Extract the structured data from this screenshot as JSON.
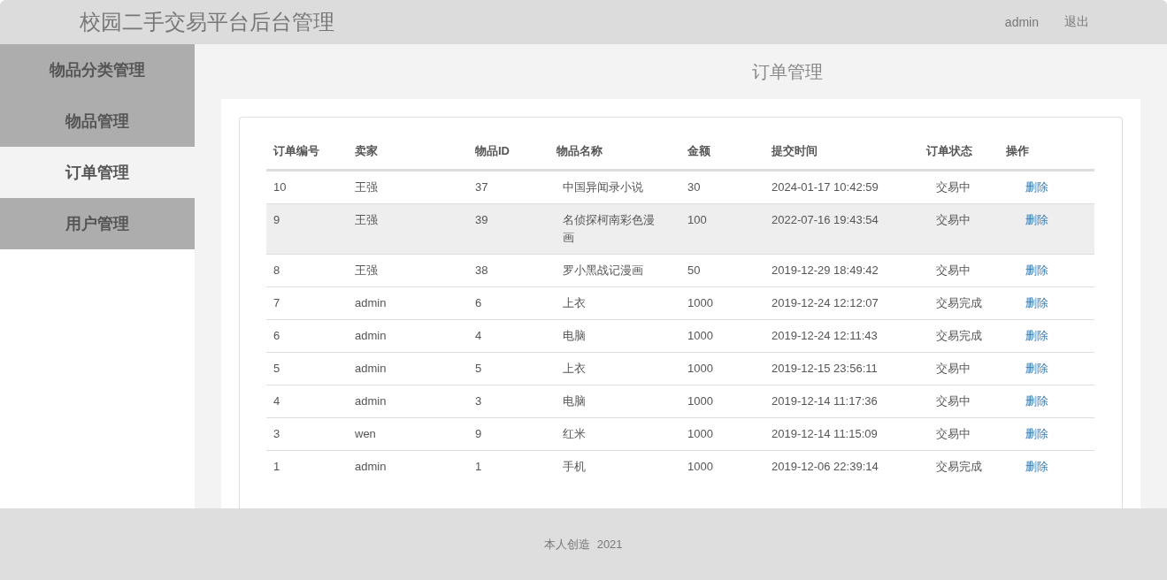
{
  "header": {
    "title": "校园二手交易平台后台管理",
    "user": "admin",
    "logout": "退出"
  },
  "sidebar": {
    "items": [
      {
        "label": "物品分类管理",
        "selected": false
      },
      {
        "label": "物品管理",
        "selected": false
      },
      {
        "label": "订单管理",
        "selected": true
      },
      {
        "label": "用户管理",
        "selected": false
      }
    ]
  },
  "page_title": "订单管理",
  "table": {
    "columns": [
      "订单编号",
      "卖家",
      "物品ID",
      "物品名称",
      "金额",
      "提交时间",
      "订单状态",
      "操作"
    ],
    "rows": [
      {
        "cells": [
          "10",
          "王强",
          "37",
          "中国异闻录小说",
          "30",
          "2024-01-17 10:42:59",
          "交易中",
          "删除"
        ],
        "highlighted": false
      },
      {
        "cells": [
          "9",
          "王强",
          "39",
          "名侦探柯南彩色漫画",
          "100",
          "2022-07-16 19:43:54",
          "交易中",
          "删除"
        ],
        "highlighted": true
      },
      {
        "cells": [
          "8",
          "王强",
          "38",
          "罗小黑战记漫画",
          "50",
          "2019-12-29 18:49:42",
          "交易中",
          "删除"
        ],
        "highlighted": false
      },
      {
        "cells": [
          "7",
          "admin",
          "6",
          "上衣",
          "1000",
          "2019-12-24 12:12:07",
          "交易完成",
          "删除"
        ],
        "highlighted": false
      },
      {
        "cells": [
          "6",
          "admin",
          "4",
          "电脑",
          "1000",
          "2019-12-24 12:11:43",
          "交易完成",
          "删除"
        ],
        "highlighted": false
      },
      {
        "cells": [
          "5",
          "admin",
          "5",
          "上衣",
          "1000",
          "2019-12-15 23:56:11",
          "交易中",
          "删除"
        ],
        "highlighted": false
      },
      {
        "cells": [
          "4",
          "admin",
          "3",
          "电脑",
          "1000",
          "2019-12-14 11:17:36",
          "交易中",
          "删除"
        ],
        "highlighted": false
      },
      {
        "cells": [
          "3",
          "wen",
          "9",
          "红米",
          "1000",
          "2019-12-14 11:15:09",
          "交易中",
          "删除"
        ],
        "highlighted": false
      },
      {
        "cells": [
          "1",
          "admin",
          "1",
          "手机",
          "1000",
          "2019-12-06 22:39:14",
          "交易完成",
          "删除"
        ],
        "highlighted": false
      }
    ]
  },
  "footer": "本人创造  2021"
}
